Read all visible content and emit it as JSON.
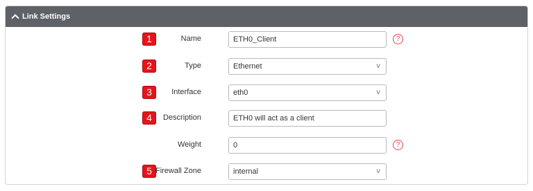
{
  "panel": {
    "title": "Link Settings",
    "collapse_icon": "chevron-up-icon"
  },
  "colors": {
    "header_bg": "#5e6166",
    "badge_bg": "#e5141b",
    "help_icon": "#e2474b"
  },
  "help_icon": "?",
  "select_caret": "v",
  "fields": [
    {
      "badge": "1",
      "label": "Name",
      "kind": "text",
      "value": "ETH0_Client",
      "help": true
    },
    {
      "badge": "2",
      "label": "Type",
      "kind": "select",
      "value": "Ethernet",
      "help": false
    },
    {
      "badge": "3",
      "label": "Interface",
      "kind": "select",
      "value": "eth0",
      "help": false
    },
    {
      "badge": "4",
      "label": "Description",
      "kind": "text",
      "value": "ETH0 will act as a client",
      "help": false
    },
    {
      "badge": "",
      "label": "Weight",
      "kind": "text",
      "value": "0",
      "help": true
    },
    {
      "badge": "5",
      "label": "Firewall Zone",
      "kind": "select",
      "value": "internal",
      "help": false
    }
  ]
}
